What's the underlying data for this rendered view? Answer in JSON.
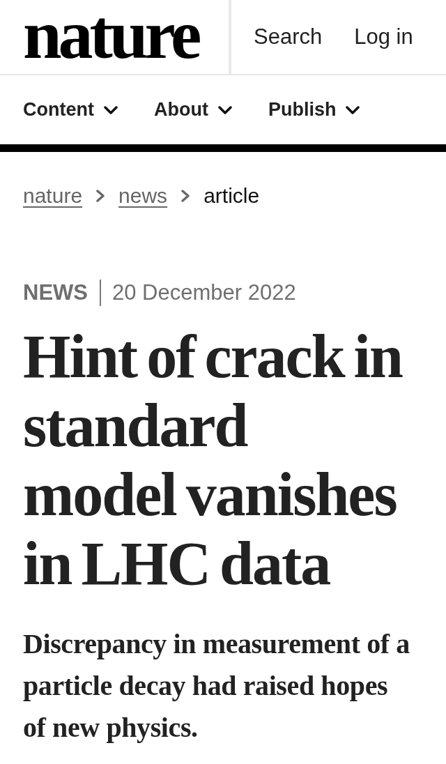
{
  "header": {
    "logo": "nature",
    "links": [
      "Search",
      "Log in"
    ]
  },
  "nav": {
    "items": [
      "Content",
      "About",
      "Publish"
    ]
  },
  "breadcrumb": [
    {
      "label": "nature",
      "kind": "link"
    },
    {
      "label": "news",
      "kind": "link"
    },
    {
      "label": "article",
      "kind": "current"
    }
  ],
  "article": {
    "type": "NEWS",
    "date": "20 December 2022",
    "title": "Hint of crack in standard model vanishes in LHC data",
    "standfirst": "Discrepancy in measurement of a particle decay had raised hopes of new physics."
  }
}
